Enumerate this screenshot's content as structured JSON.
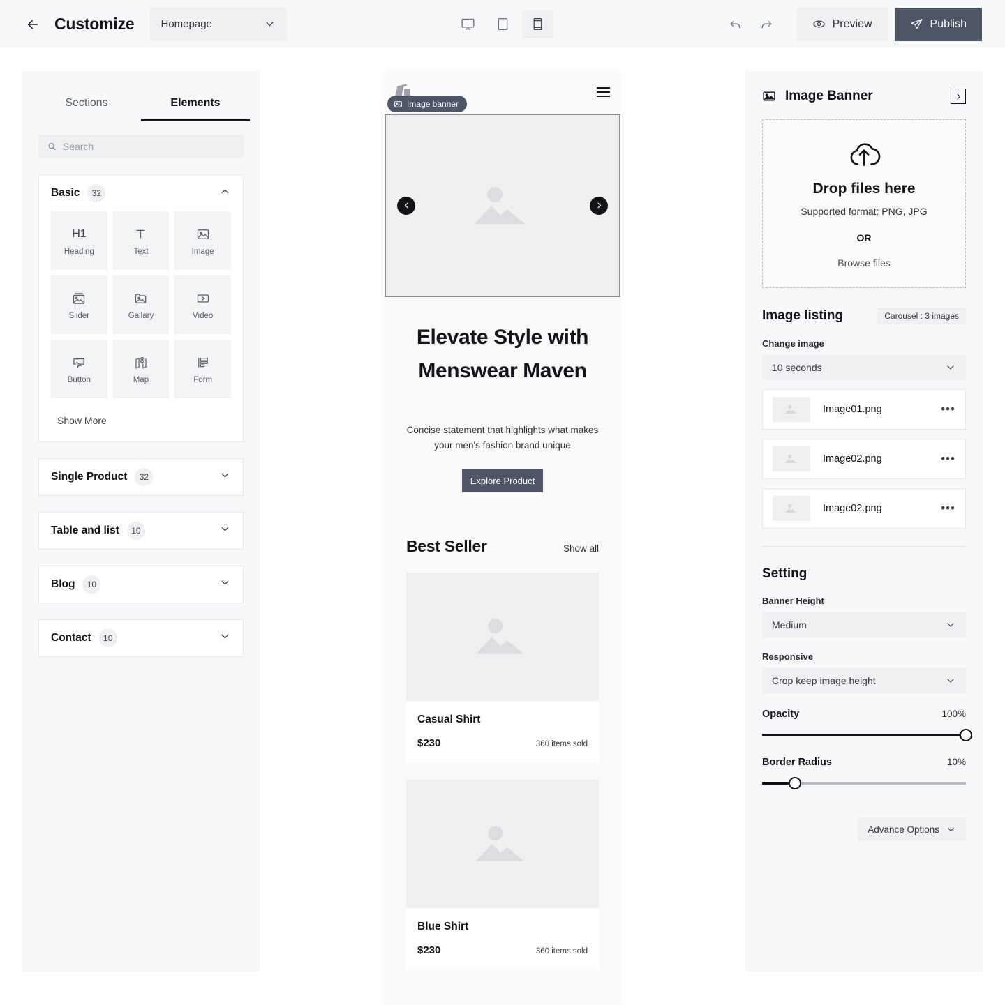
{
  "topbar": {
    "back_icon": "arrow-left-icon",
    "title": "Customize",
    "page_select": {
      "value": "Homepage",
      "chevron": "chevron-down-icon"
    },
    "devices": [
      {
        "name": "desktop",
        "icon": "desktop-icon",
        "active": false
      },
      {
        "name": "tablet",
        "icon": "tablet-icon",
        "active": false
      },
      {
        "name": "mobile",
        "icon": "mobile-icon",
        "active": true
      }
    ],
    "undo_icon": "undo-icon",
    "redo_icon": "redo-icon",
    "preview_label": "Preview",
    "preview_icon": "eye-icon",
    "publish_label": "Publish",
    "publish_icon": "send-icon",
    "publish_color": "#4d5566"
  },
  "sidebar": {
    "tabs": [
      {
        "label": "Sections",
        "active": false
      },
      {
        "label": "Elements",
        "active": true
      }
    ],
    "search": {
      "placeholder": "Search",
      "value": "",
      "icon": "search-icon"
    },
    "basic": {
      "title": "Basic",
      "count": "32",
      "chevron": "chevron-up-icon",
      "elements": [
        {
          "label": "Heading",
          "icon": "heading-h1-icon"
        },
        {
          "label": "Text",
          "icon": "text-t-icon"
        },
        {
          "label": "Image",
          "icon": "image-icon"
        },
        {
          "label": "Slider",
          "icon": "slider-icon"
        },
        {
          "label": "Gallary",
          "icon": "gallery-icon"
        },
        {
          "label": "Video",
          "icon": "video-icon"
        },
        {
          "label": "Button",
          "icon": "button-cursor-icon"
        },
        {
          "label": "Map",
          "icon": "map-pin-icon"
        },
        {
          "label": "Form",
          "icon": "form-icon"
        }
      ],
      "show_more": "Show More"
    },
    "groups": [
      {
        "title": "Single Product",
        "count": "32",
        "chevron": "chevron-down-icon"
      },
      {
        "title": "Table and list",
        "count": "10",
        "chevron": "chevron-down-icon"
      },
      {
        "title": "Blog",
        "count": "10",
        "chevron": "chevron-down-icon"
      },
      {
        "title": "Contact",
        "count": "10",
        "chevron": "chevron-down-icon"
      }
    ]
  },
  "preview": {
    "badge": {
      "label": "Image banner",
      "icon": "image-icon",
      "color": "#4d5566"
    },
    "menu_icon": "hamburger-menu-icon",
    "banner": {
      "placeholder_icon": "image-placeholder-icon",
      "prev_icon": "chevron-left-icon",
      "next_icon": "chevron-right-icon"
    },
    "hero": {
      "heading_line1": "Elevate Style with",
      "heading_line2": "Menswear Maven",
      "paragraph": "Concise statement that highlights what makes your men's fashion brand unique",
      "cta_label": "Explore Product"
    },
    "best_seller": {
      "title": "Best Seller",
      "show_all": "Show all",
      "products": [
        {
          "name": "Casual Shirt",
          "price": "$230",
          "sold": "360 items sold"
        },
        {
          "name": "Blue Shirt",
          "price": "$230",
          "sold": "360 items sold"
        }
      ]
    }
  },
  "inspector": {
    "header": {
      "title": "Image Banner",
      "icon": "image-icon",
      "expand_icon": "chevron-right-box-icon"
    },
    "dropzone": {
      "icon": "cloud-upload-icon",
      "title": "Drop files here",
      "subtitle": "Supported format: PNG, JPG",
      "or": "OR",
      "browse": "Browse files"
    },
    "image_listing": {
      "title": "Image listing",
      "badge": "Carousel : 3 images",
      "change_image_label": "Change image",
      "change_image_value": "10 seconds",
      "chevron": "chevron-down-icon",
      "files": [
        {
          "name": "Image01.png",
          "thumb_icon": "image-placeholder-icon",
          "more_icon": "more-horizontal-icon"
        },
        {
          "name": "Image02.png",
          "thumb_icon": "image-placeholder-icon",
          "more_icon": "more-horizontal-icon"
        },
        {
          "name": "Image02.png",
          "thumb_icon": "image-placeholder-icon",
          "more_icon": "more-horizontal-icon"
        }
      ]
    },
    "setting": {
      "title": "Setting",
      "banner_height_label": "Banner Height",
      "banner_height_value": "Medium",
      "responsive_label": "Responsive",
      "responsive_value": "Crop keep image height",
      "opacity_label": "Opacity",
      "opacity_value": "100%",
      "opacity_percent": 100,
      "border_radius_label": "Border Radius",
      "border_radius_value": "10%",
      "border_radius_percent": 16,
      "advance_options": "Advance Options",
      "advance_chevron": "chevron-down-icon"
    }
  }
}
